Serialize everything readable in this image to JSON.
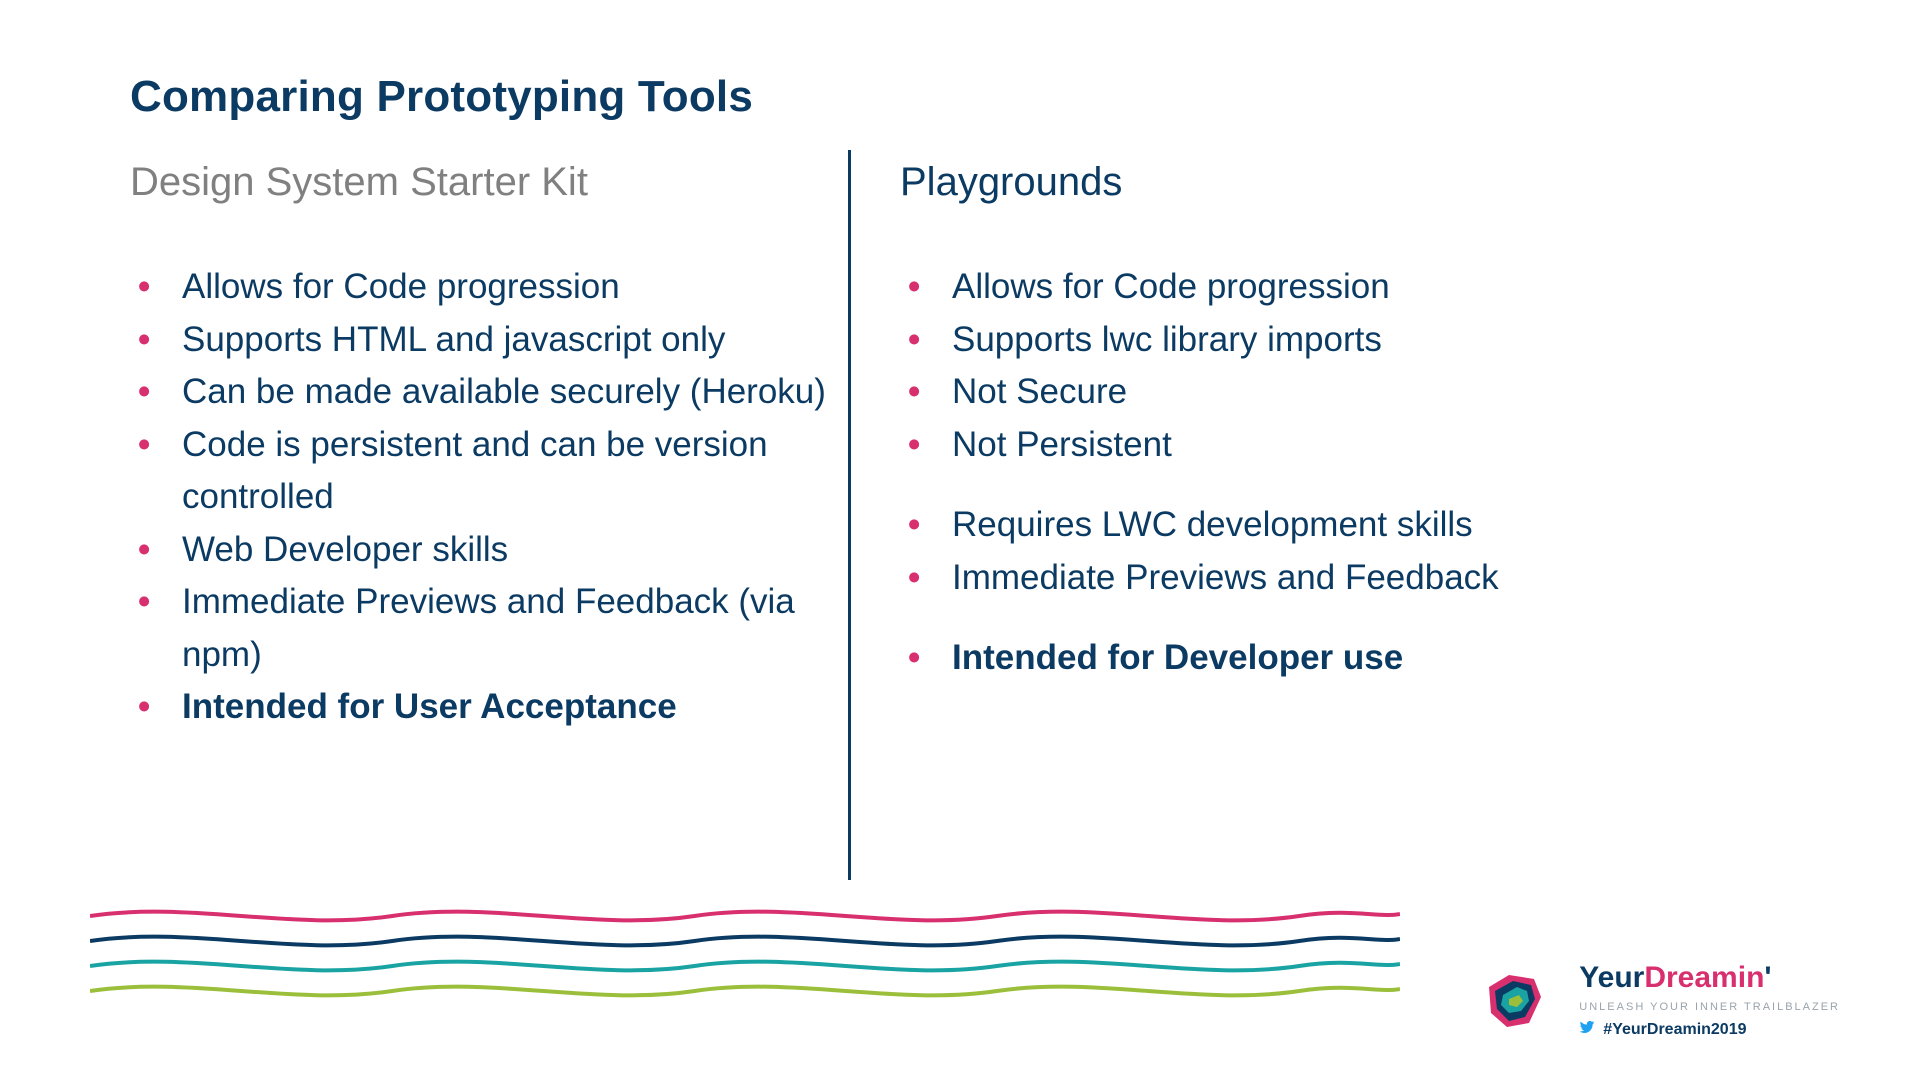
{
  "title": "Comparing Prototyping Tools",
  "left": {
    "heading": "Design System Starter Kit",
    "items": [
      {
        "text": "Allows for Code progression",
        "bold": false
      },
      {
        "text": "Supports HTML and javascript only",
        "bold": false
      },
      {
        "text": "Can be made available securely (Heroku)",
        "bold": false
      },
      {
        "text": "Code is persistent and can be version controlled",
        "bold": false
      },
      {
        "text": "Web Developer skills",
        "bold": false
      },
      {
        "text": "Immediate Previews and Feedback (via npm)",
        "bold": false
      },
      {
        "text": "Intended for User Acceptance",
        "bold": true
      }
    ]
  },
  "right": {
    "heading": "Playgrounds",
    "group1": [
      {
        "text": "Allows for Code progression",
        "bold": false
      },
      {
        "text": "Supports lwc library imports",
        "bold": false
      },
      {
        "text": "Not Secure",
        "bold": false
      },
      {
        "text": "Not Persistent",
        "bold": false
      }
    ],
    "group2": [
      {
        "text": "Requires LWC development skills",
        "bold": false
      },
      {
        "text": "Immediate Previews and Feedback",
        "bold": false
      }
    ],
    "group3": [
      {
        "text": "Intended for Developer use",
        "bold": true
      }
    ]
  },
  "brand": {
    "part1": "Yeur",
    "part2": "Dreamin",
    "apostrophe": "'",
    "subtitle": "UNLEASH YOUR INNER TRAILBLAZER",
    "hashtag": "#YeurDreamin2019"
  },
  "colors": {
    "navy": "#0b3a63",
    "pink": "#d82f6e",
    "teal": "#1aa3a3",
    "green": "#9bbf3b",
    "grey": "#808080"
  }
}
